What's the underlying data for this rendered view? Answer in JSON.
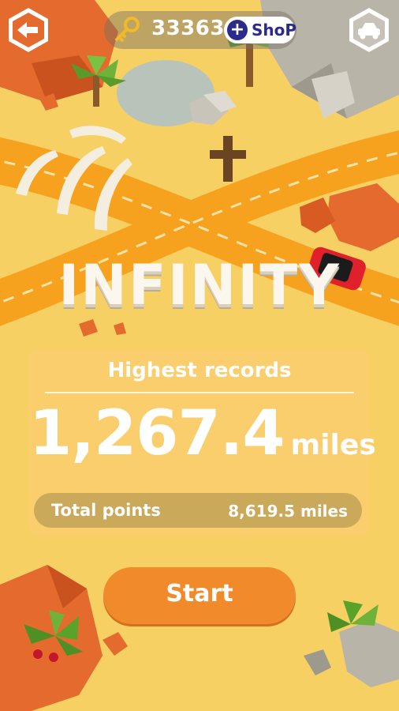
{
  "header": {
    "back_icon": "back-arrow-icon",
    "garage_icon": "car-icon",
    "keys": {
      "icon": "key-icon",
      "count": "33363"
    },
    "shop": {
      "icon": "plus-icon",
      "label": "ShoP"
    }
  },
  "mode_title": "INFINITY",
  "records": {
    "title": "Highest records",
    "best_value": "1,267.4",
    "best_unit": "miles",
    "total_label": "Total points",
    "total_value": "8,619.5 miles"
  },
  "start_label": "Start",
  "colors": {
    "sand": "#f7d064",
    "road": "#f6a21e",
    "rock_orange": "#e56a2d",
    "accent_orange": "#f08a2a",
    "shop_blue": "#2a2b8c",
    "car_red": "#e0202a"
  }
}
